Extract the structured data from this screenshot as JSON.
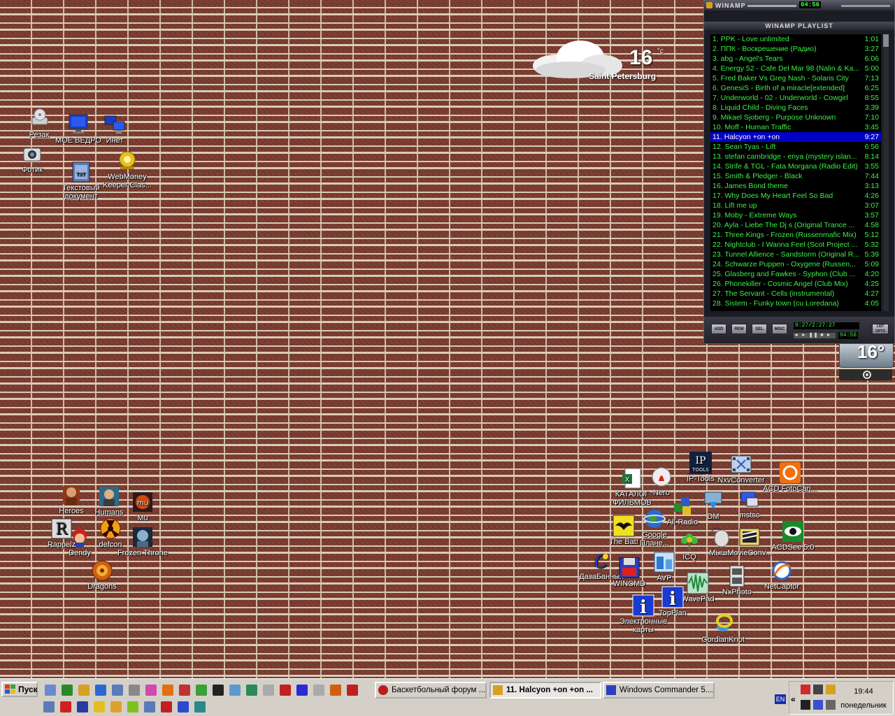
{
  "desktop": {
    "icons_left": [
      {
        "label": "Резак",
        "icon": "cd-drive-icon"
      },
      {
        "label": "МОЕ ВЕДРО",
        "icon": "computer-icon"
      },
      {
        "label": "Инет",
        "icon": "network-icon"
      },
      {
        "label": "Фотик",
        "icon": "camera-icon"
      },
      {
        "label": "Текстовый документ",
        "icon": "text-document-icon"
      },
      {
        "label": "WebMoney Keeper Clas...",
        "icon": "webmoney-icon"
      }
    ],
    "icons_games": [
      {
        "label": "Heroes",
        "icon": "heroes-icon"
      },
      {
        "label": "Humans",
        "icon": "humans-icon"
      },
      {
        "label": "Mu",
        "icon": "mu-icon"
      },
      {
        "label": "Rappelz",
        "icon": "rappelz-icon"
      },
      {
        "label": "Dendy",
        "icon": "dendy-icon"
      },
      {
        "label": "defcon",
        "icon": "defcon-icon"
      },
      {
        "label": "Frozen Throne",
        "icon": "frozen-throne-icon"
      },
      {
        "label": "Dragons",
        "icon": "dragons-icon"
      }
    ],
    "icons_right": [
      {
        "label": "КАТАЛОГ ФИЛЬМОВ",
        "icon": "excel-icon"
      },
      {
        "label": "Nero",
        "icon": "nero-icon"
      },
      {
        "label": "IP-Tools",
        "icon": "ip-tools-icon",
        "text": "IP TOOLS"
      },
      {
        "label": "NxvConverter",
        "icon": "film-icon"
      },
      {
        "label": "ACD FotoCan...",
        "icon": "acd-icon"
      },
      {
        "label": "All-Radio",
        "icon": "all-radio-icon"
      },
      {
        "label": "DM",
        "icon": "download-manager-icon"
      },
      {
        "label": "mstsc",
        "icon": "remote-desktop-icon"
      },
      {
        "label": "The Bat!",
        "icon": "the-bat-icon"
      },
      {
        "label": "Google Плане...",
        "icon": "google-earth-icon"
      },
      {
        "label": "ICQ",
        "icon": "icq-icon"
      },
      {
        "label": "Мышь",
        "icon": "mouse-icon"
      },
      {
        "label": "MovieConv...",
        "icon": "movie-converter-icon"
      },
      {
        "label": "ACDSee 5.0",
        "icon": "acdsee-icon"
      },
      {
        "label": "ДазаБанных",
        "icon": "database-icon"
      },
      {
        "label": "WINCMD",
        "icon": "wincmd-icon"
      },
      {
        "label": "AVP",
        "icon": "avp-icon"
      },
      {
        "label": "WavePad",
        "icon": "wavepad-icon"
      },
      {
        "label": "NxPhoto",
        "icon": "nxphoto-icon"
      },
      {
        "label": "NetCaptor",
        "icon": "netcaptor-icon"
      },
      {
        "label": "TopPlan",
        "icon": "info-icon"
      },
      {
        "label": "Электронные карты",
        "icon": "info-icon"
      },
      {
        "label": "GordianKnot",
        "icon": "gordianknot-icon"
      }
    ]
  },
  "weather": {
    "temp": "16",
    "unit": "°c",
    "city": "Saint Petersburg"
  },
  "weather_small": {
    "temp": "16°"
  },
  "winamp": {
    "title": "WINAMP",
    "time": "04:56",
    "playlist_title": "WINAMP PLAYLIST",
    "selected_index": 10,
    "tracks": [
      {
        "name": "1. PPK - Love unlimited",
        "dur": "1:01"
      },
      {
        "name": "2. ППК - Воскрешение (Радио)",
        "dur": "3:27"
      },
      {
        "name": "3. abg - Angel's Tears",
        "dur": "6:06"
      },
      {
        "name": "4. Energy 52 - Cafe Del Mar 98 (Nalin & Ka...",
        "dur": "5:00"
      },
      {
        "name": "5. Fred Baker Vs Greg Nash - Solaris City",
        "dur": "7:13"
      },
      {
        "name": "6. GenesiS - Birth of a miracle[extended]",
        "dur": "6:25"
      },
      {
        "name": "7. Underworld - 02 - Underworld - Cowgirl",
        "dur": "8:55"
      },
      {
        "name": "8. Liquid Child - Diving Faces",
        "dur": "3:39"
      },
      {
        "name": "9. Mikael Sjoberg - Purpose Unknown",
        "dur": "7:10"
      },
      {
        "name": "10. Moff - Human Traffic",
        "dur": "3:45"
      },
      {
        "name": "11. Halcyon +on +on",
        "dur": "9:27"
      },
      {
        "name": "12. Sean Tyas - Lift",
        "dur": "6:56"
      },
      {
        "name": "13. stefan cambridge - enya (mystery islan...",
        "dur": "8:14"
      },
      {
        "name": "14. Strife & TGL - Fata Morgana (Radio Edit)",
        "dur": "3:55"
      },
      {
        "name": "15. Smith & Pledger - Black",
        "dur": "7:44"
      },
      {
        "name": "16. James Bond theme",
        "dur": "3:13"
      },
      {
        "name": "17. Why Does My Heart Feel So Bad",
        "dur": "4:26"
      },
      {
        "name": "18. Lift me up",
        "dur": "3:07"
      },
      {
        "name": "19. Moby - Extreme Ways",
        "dur": "3:57"
      },
      {
        "name": "20. Ayla - Liebe The Dj s (Original Trance ...",
        "dur": "4:58"
      },
      {
        "name": "21. Three Kings - Frozen (Russenmafic Mix)",
        "dur": "5:12"
      },
      {
        "name": "22. Nightclub - I Wanna Feel (Scot Project ...",
        "dur": "5:32"
      },
      {
        "name": "23. Tunnel Allience - Sandstorm (Original R...",
        "dur": "5:39"
      },
      {
        "name": "24. Schwarze Puppen - Oxygene (Russen...",
        "dur": "5:09"
      },
      {
        "name": "25. Glasberg and Fawkes - Syphon (Club ...",
        "dur": "4:20"
      },
      {
        "name": "26. Phonekiller - Cosmic Angel (Club Mix)",
        "dur": "4:25"
      },
      {
        "name": "27. The Servant - Cells (instrumental)",
        "dur": "4:27"
      },
      {
        "name": "28. Sistem - Funky town (cu Loredana)",
        "dur": "4:05"
      }
    ],
    "buttons": [
      "ADD",
      "REM",
      "SEL",
      "MISC"
    ],
    "list_opts": "LIST OPTS",
    "info": "9:27/2:27:27",
    "time2": "04:56"
  },
  "taskbar": {
    "start_label": "Пуск",
    "tasks": [
      {
        "label": "Баскетбольный форум ...",
        "active": false
      },
      {
        "label": "11. Halcyon +on +on ...",
        "active": true
      },
      {
        "label": "Windows Commander 5....",
        "active": false
      }
    ],
    "lang": "EN",
    "clock": "19:44",
    "day": "понедельник"
  },
  "colors": {
    "playlist_text": "#3cf044",
    "playlist_selected_bg": "#0000c6",
    "taskbar": "#d4d0c8"
  }
}
